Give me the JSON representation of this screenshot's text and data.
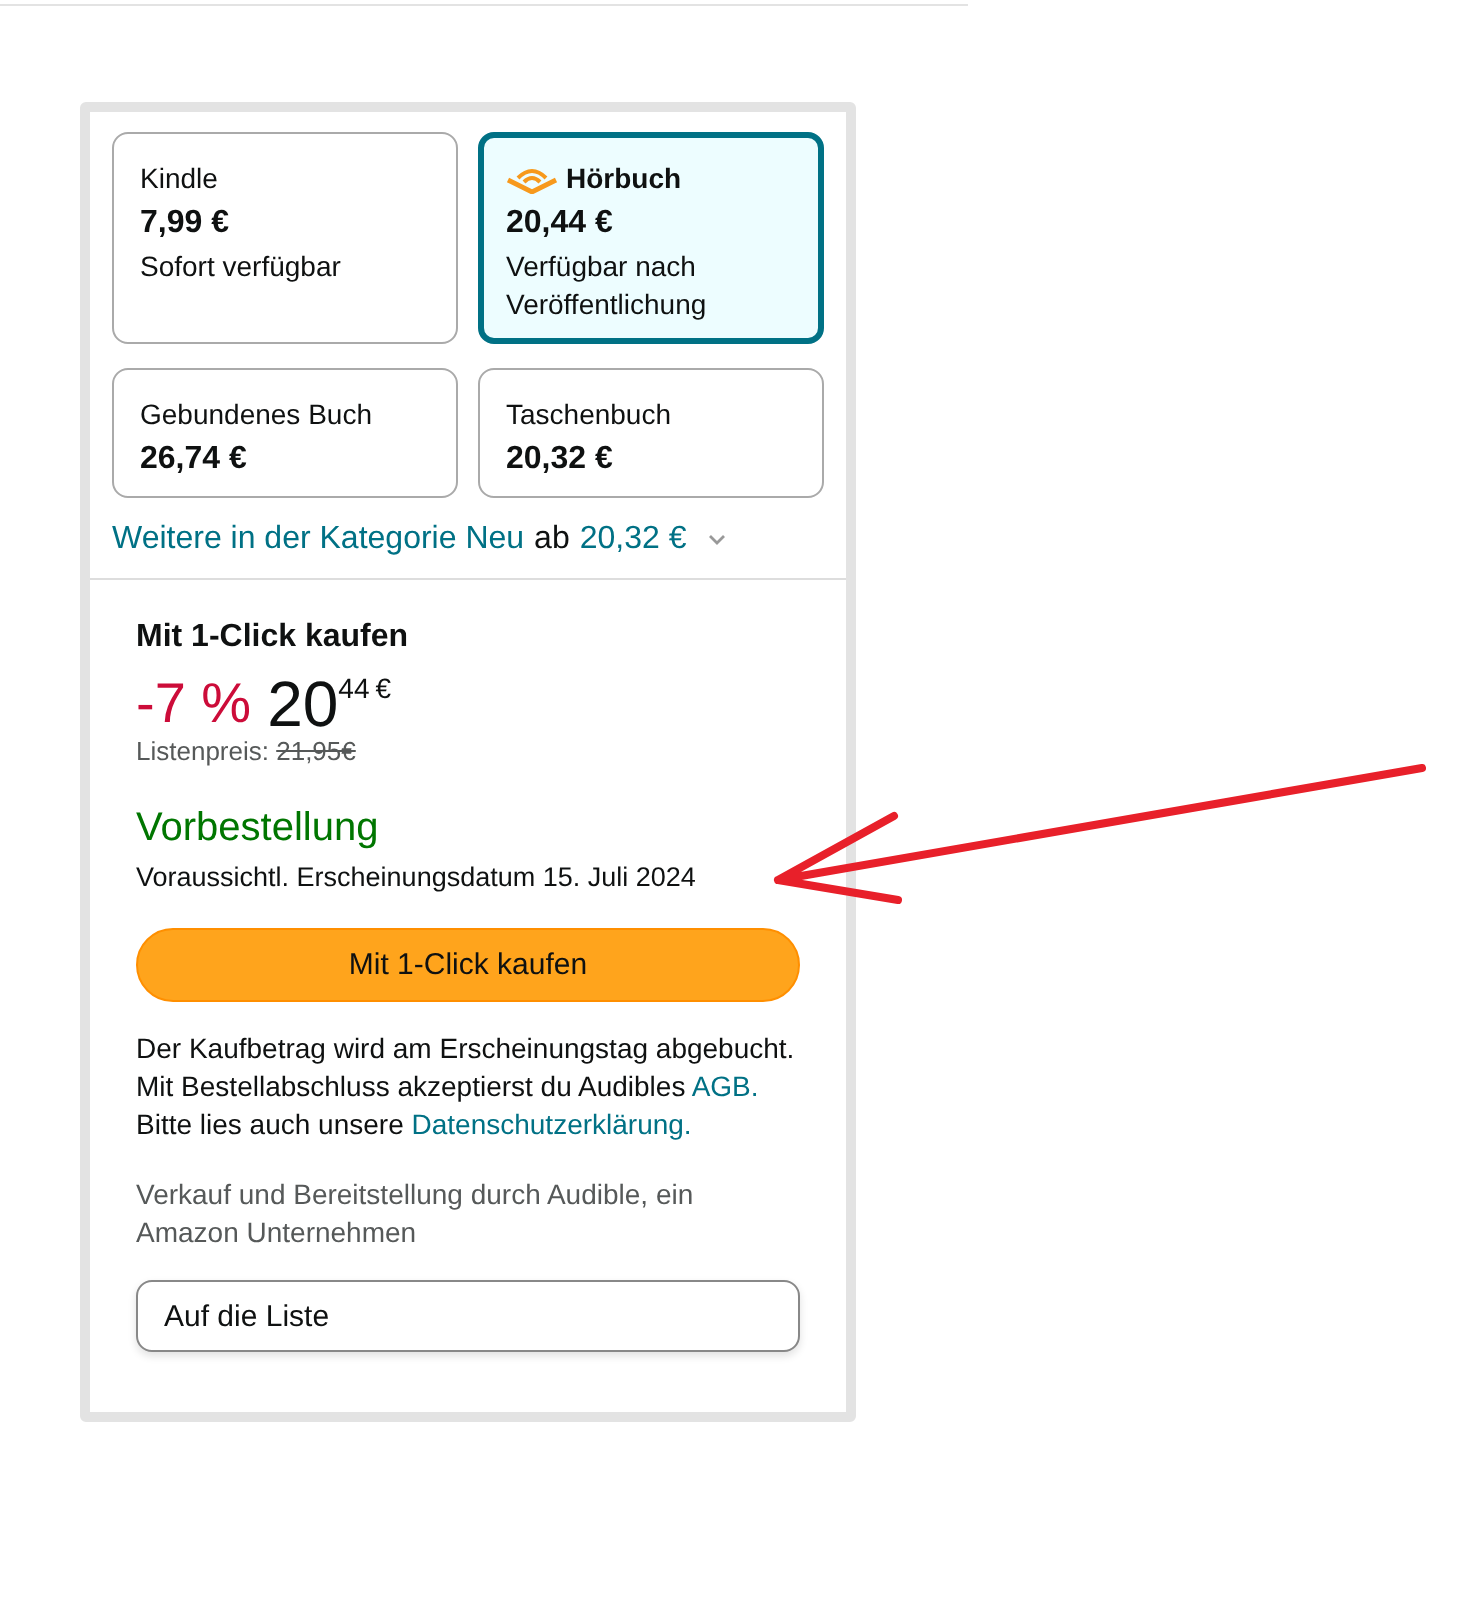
{
  "formats": [
    {
      "kind": "plain",
      "name": "Kindle",
      "price": "7,99 €",
      "availability": "Sofort verfügbar",
      "selected": false
    },
    {
      "kind": "audiobook",
      "name": "Hörbuch",
      "price": "20,44 €",
      "availability": "Verfügbar nach Veröffentlichung",
      "selected": true
    },
    {
      "kind": "plain",
      "name": "Gebundenes Buch",
      "price": "26,74 €",
      "selected": false
    },
    {
      "kind": "plain",
      "name": "Taschenbuch",
      "price": "20,32 €",
      "selected": false
    }
  ],
  "more_link": {
    "text": "Weitere in der Kategorie Neu",
    "from_word": "ab",
    "price": "20,32 €"
  },
  "buy_box": {
    "heading": "Mit 1-Click kaufen",
    "discount": "-7 %",
    "price_whole": "20",
    "price_fraction": "44",
    "currency": "€",
    "list_price_label": "Listenpreis:",
    "list_price": "21,95€",
    "status": "Vorbestellung",
    "release": "Voraussichtl. Erscheinungsdatum 15. Juli 2024",
    "buy_button": "Mit 1-Click kaufen",
    "notice_1": "Der Kaufbetrag wird am Erscheinungstag abgebucht.",
    "notice_2": "Mit Bestellabschluss akzeptierst du Audibles",
    "terms_link": "AGB.",
    "notice_3": "Bitte lies auch unsere",
    "privacy_link": "Datenschutzerklärung.",
    "seller": "Verkauf und Bereitstellung durch Audible, ein Amazon Unternehmen",
    "list_button": "Auf die Liste"
  }
}
